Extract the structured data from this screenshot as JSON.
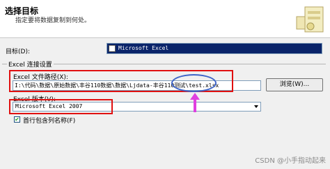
{
  "header": {
    "title": "选择目标",
    "subtitle": "指定要将数据复制到何处。"
  },
  "destination": {
    "label": "目标(D):",
    "value": "Microsoft Excel"
  },
  "connection": {
    "group_title": "Excel 连接设置",
    "path_label": "Excel 文件路径(X):",
    "path_value": "I:\\代码\\数据\\原始数据\\丰谷110数据\\数据\\Ljdata-丰谷110测试\\test.xlsx",
    "browse_label": "浏览(W)...",
    "version_label": "Excel 版本(V):",
    "version_value": "Microsoft Excel 2007",
    "first_row_label": "首行包含列名称(F)",
    "first_row_checked": true
  },
  "annotations": {
    "highlight_color": "#e01010",
    "ellipse_color": "#3e64c8",
    "arrow_color": "#e040e0"
  },
  "watermark": "CSDN @小手指动起来"
}
